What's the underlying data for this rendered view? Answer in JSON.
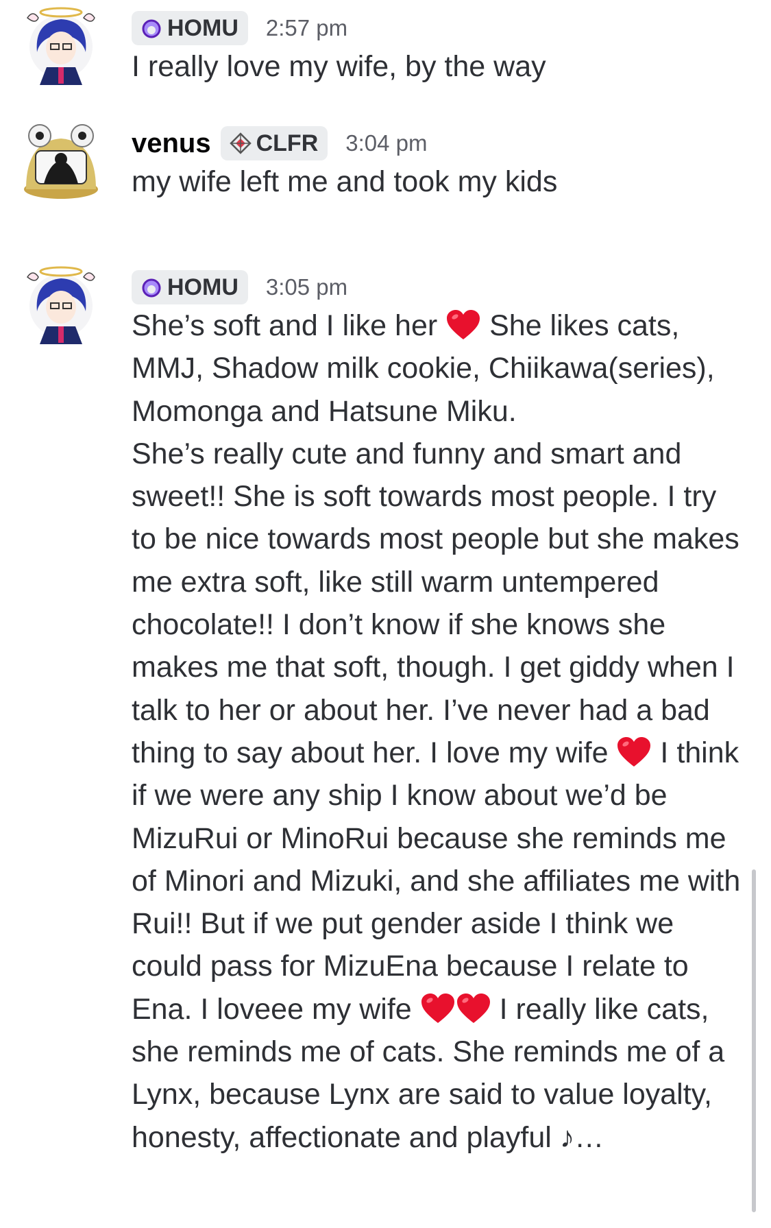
{
  "messages": [
    {
      "author_tag": "HOMU",
      "time": "2:57 pm",
      "text": "I really love my wife, by the way"
    },
    {
      "author_name": "venus",
      "author_tag": "CLFR",
      "time": "3:04 pm",
      "text": "my wife left me and took my kids"
    },
    {
      "author_tag": "HOMU",
      "time": "3:05 pm",
      "segments": [
        "She’s soft and I like her ",
        " She likes cats, MMJ, Shadow milk cookie, Chiikawa(series), Momonga and Hatsune Miku.\nShe’s really cute and funny and smart and sweet!! She is soft towards most people. I try to be nice towards most people but she makes me extra soft, like still warm untempered chocolate!! I don’t know if she knows she makes me that soft, though. I get giddy when I talk to her or about her. I’ve never had a bad thing to say about her. I love my wife ",
        " I think if we were any ship I know about we’d be MizuRui or MinoRui because she reminds me of Minori and Mizuki, and she affiliates me with Rui!! But if we put gender aside I think we could pass for MizuEna because I relate to Ena. I loveee my wife ",
        " I really like cats, she reminds me of cats. She reminds me of a Lynx, because Lynx are said to value loyalty, honesty, affectionate and playful ♪…"
      ]
    }
  ],
  "icons": {
    "homu_tag_icon": "purple-ring-icon",
    "clfr_tag_icon": "diamond-crosshair-icon",
    "heart": "red-heart-emoji"
  },
  "colors": {
    "heart": "#e8112d",
    "tag_bg": "#ebedef",
    "homu_icon": "#8b5cf6"
  }
}
